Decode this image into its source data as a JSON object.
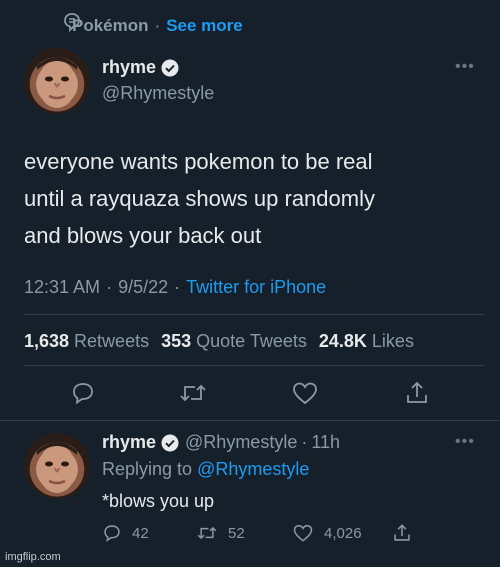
{
  "topic": {
    "icon": "topic-icon",
    "name": "Pokémon",
    "separator": "·",
    "see_more": "See more"
  },
  "tweet": {
    "author": {
      "display_name": "rhyme",
      "handle": "@Rhymestyle",
      "verified": true,
      "avatar": "profile-photo"
    },
    "text_lines": [
      "everyone wants pokemon to be real",
      "until a rayquaza shows up randomly",
      "and blows your back out"
    ],
    "time": "12:31 AM",
    "date": "9/5/22",
    "source": "Twitter for iPhone",
    "stats": {
      "retweets": "1,638",
      "retweets_label": "Retweets",
      "quotes": "353",
      "quotes_label": "Quote Tweets",
      "likes": "24.8K",
      "likes_label": "Likes"
    },
    "actions": [
      "reply-icon",
      "retweet-icon",
      "like-icon",
      "share-icon"
    ]
  },
  "reply": {
    "display_name": "rhyme",
    "handle": "@Rhymestyle",
    "age": "11h",
    "replying_label": "Replying to",
    "replying_to": "@Rhymestyle",
    "text": "*blows you up",
    "counts": {
      "replies": "42",
      "retweets": "52",
      "likes": "4,026"
    }
  },
  "watermark": "imgflip.com",
  "colors": {
    "background": "#16202b",
    "accent": "#1d9bf0",
    "muted": "#8b98a5",
    "text": "#e7e9ea"
  }
}
